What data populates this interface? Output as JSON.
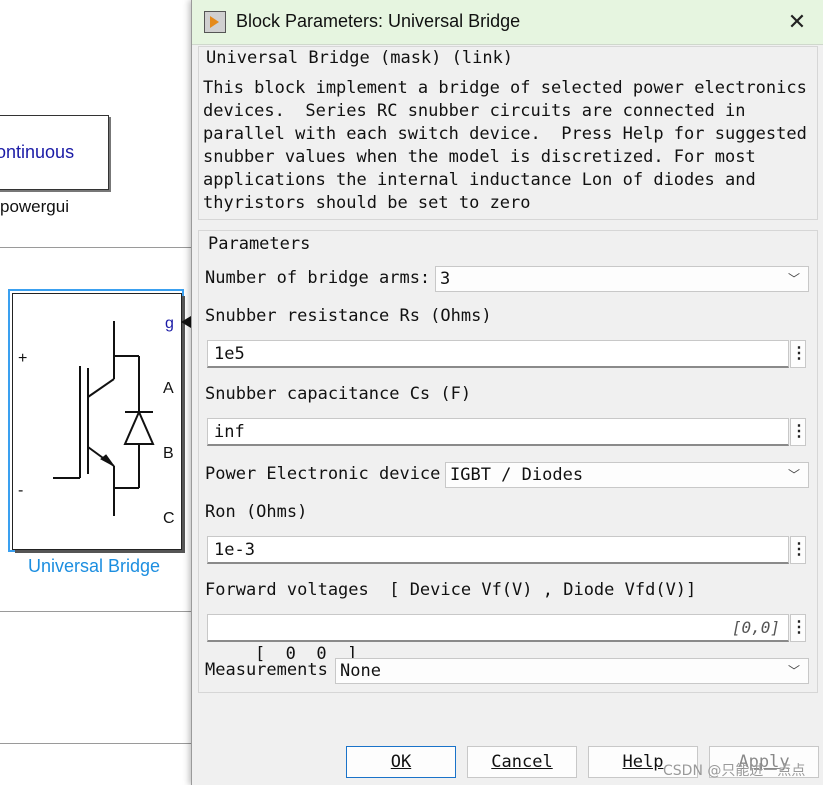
{
  "background": {
    "powergui": {
      "mode_text": "ontinuous",
      "label": "powergui"
    },
    "universal_bridge": {
      "label": "Universal Bridge",
      "ports": {
        "g": "g",
        "a": "A",
        "b": "B",
        "c": "C",
        "plus": "+",
        "minus": "-"
      }
    }
  },
  "dialog": {
    "title": "Block Parameters: Universal Bridge",
    "close_glyph": "✕",
    "description": {
      "title": "Universal Bridge (mask) (link)",
      "body": "This block implement a bridge of selected power electronics\ndevices.  Series RC snubber circuits are connected in\nparallel with each switch device.  Press Help for suggested\nsnubber values when the model is discretized. For most\napplications the internal inductance Lon of diodes and\nthyristors should be set to zero"
    },
    "parameters": {
      "title": "Parameters",
      "bridge_arms": {
        "label": "Number of bridge arms:",
        "value": "3"
      },
      "snubber_rs": {
        "label": "Snubber resistance Rs (Ohms)",
        "value": "1e5"
      },
      "snubber_cs": {
        "label": "Snubber capacitance Cs (F)",
        "value": "inf"
      },
      "device": {
        "label": "Power Electronic device",
        "value": "IGBT / Diodes"
      },
      "ron": {
        "label": "Ron (Ohms)",
        "value": "1e-3"
      },
      "forward_voltages": {
        "label": "Forward voltages  [ Device Vf(V) , Diode Vfd(V)]",
        "value": "[  0  0  ]",
        "hint": "[0,0]"
      },
      "measurements": {
        "label": "Measurements",
        "value": "None"
      }
    },
    "buttons": {
      "ok": "OK",
      "cancel": "Cancel",
      "help": "Help",
      "apply": "Apply"
    },
    "kebab_glyph": "⋮",
    "dropdown_glyph": "﹀"
  },
  "watermark": "CSDN @只能进一点点"
}
